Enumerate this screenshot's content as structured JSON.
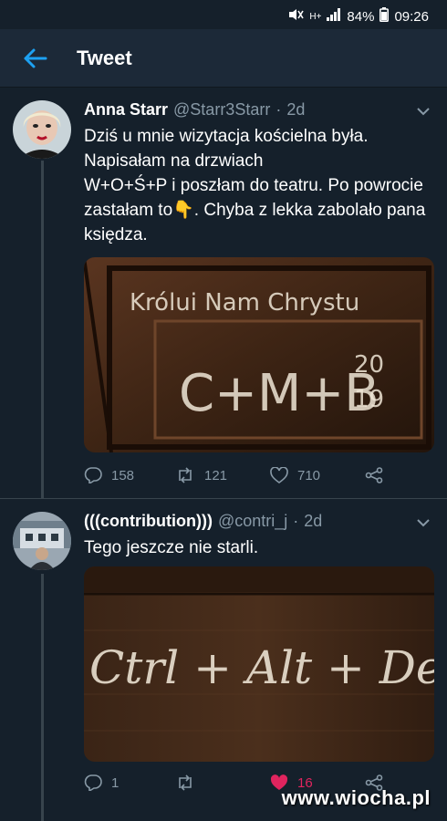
{
  "status_bar": {
    "network": "H+",
    "signal": "4G",
    "battery": "84%",
    "time": "09:26"
  },
  "header": {
    "title": "Tweet"
  },
  "tweets": [
    {
      "name": "Anna Starr",
      "handle": "@Starr3Starr",
      "separator": "·",
      "age": "2d",
      "text": "Dziś u mnie wizytacja kościelna była.\nNapisałam na drzwiach\n W+O+Ś+P i poszłam do teatru. Po powrocie zastałam to👇. Chyba z lekka zabolało pana księdza.",
      "image_text": {
        "line1": "Królui Nam Chrystu",
        "line2": "C+M+B",
        "year_top": "20",
        "year_bottom": "19"
      },
      "reply_count": "158",
      "retweet_count": "121",
      "like_count": "710"
    },
    {
      "name": "(((contribution)))",
      "handle": "@contri_j",
      "separator": "·",
      "age": "2d",
      "text": "Tego jeszcze nie starli.",
      "image_text": {
        "line1": "Ctrl + Alt + Del"
      },
      "reply_count": "1",
      "retweet_count": "",
      "like_count": "16"
    }
  ],
  "watermark": "www.wiocha.pl",
  "colors": {
    "background": "#15202b",
    "accent": "#1da1f2",
    "muted": "#8899a6",
    "like": "#e0245e"
  }
}
